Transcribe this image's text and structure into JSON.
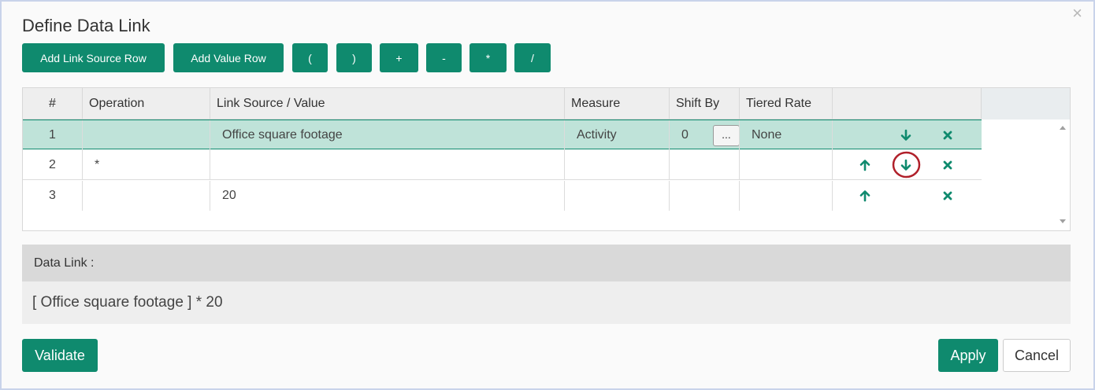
{
  "dialog": {
    "title": "Define Data Link",
    "close_symbol": "×"
  },
  "toolbar": {
    "add_link_source_row": "Add Link Source Row",
    "add_value_row": "Add Value Row",
    "open_paren": "(",
    "close_paren": ")",
    "plus": "+",
    "minus": "-",
    "multiply": "*",
    "divide": "/"
  },
  "grid": {
    "columns": [
      "#",
      "Operation",
      "Link Source / Value",
      "Measure",
      "Shift By",
      "Tiered Rate"
    ],
    "rows": [
      {
        "num": "1",
        "operation": "",
        "link_source": "Office square footage",
        "measure": "Activity",
        "shift_by": "0",
        "tiered_rate": "None",
        "selected": true,
        "actions": [
          "arrow-down-icon",
          "delete-x-icon"
        ]
      },
      {
        "num": "2",
        "operation": "*",
        "link_source": "",
        "measure": "",
        "shift_by": "",
        "tiered_rate": "",
        "selected": false,
        "actions": [
          "arrow-up-icon",
          "arrow-down-icon",
          "delete-x-icon"
        ]
      },
      {
        "num": "3",
        "operation": "",
        "link_source": "20",
        "measure": "",
        "shift_by": "",
        "tiered_rate": "",
        "selected": false,
        "actions": [
          "arrow-up-icon",
          "delete-x-icon"
        ]
      }
    ],
    "ellipsis_label": "..."
  },
  "data_link": {
    "label": "Data Link :",
    "expression": "[ Office square footage ] * 20"
  },
  "footer": {
    "validate": "Validate",
    "apply": "Apply",
    "cancel": "Cancel"
  },
  "colors": {
    "accent": "#0f8a6e",
    "selected_row": "#bfe3d9",
    "highlight_ring": "#b0202a"
  }
}
